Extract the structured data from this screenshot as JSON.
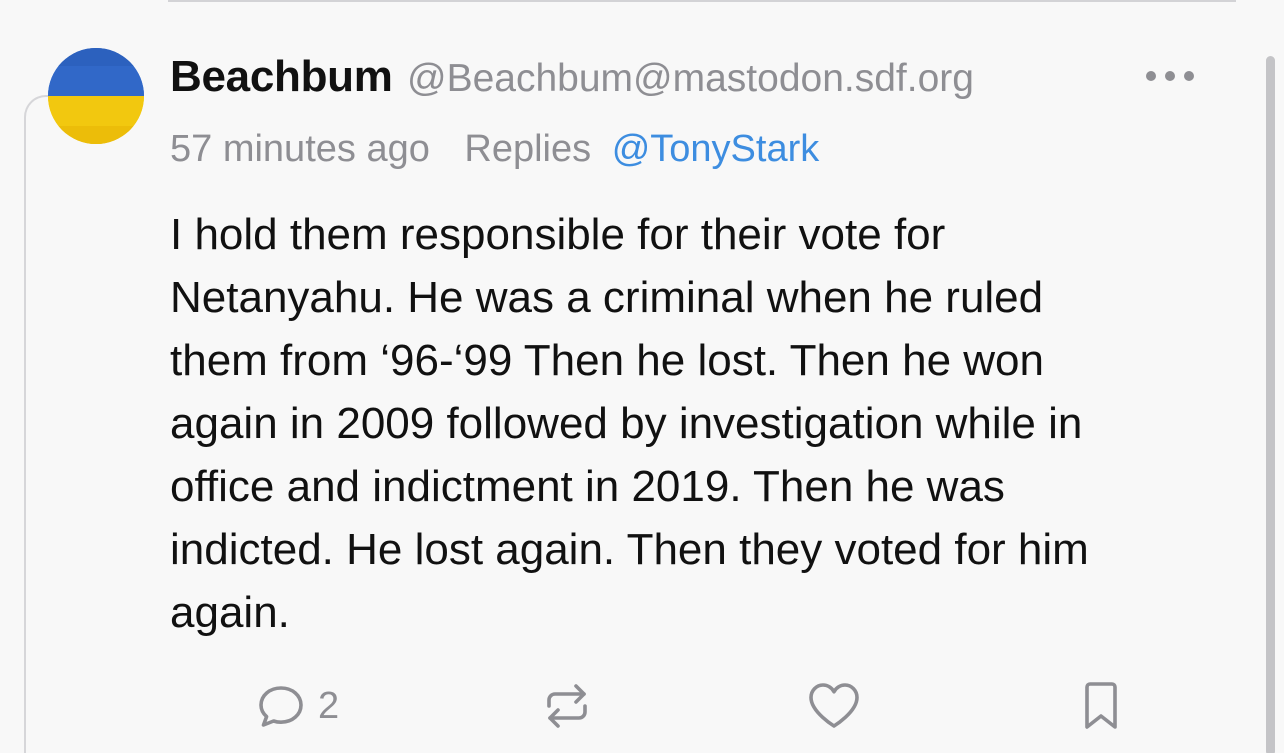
{
  "post": {
    "author": {
      "display_name": "Beachbum",
      "handle": "@Beachbum@mastodon.sdf.org",
      "avatar": "ukraine-flag-avatar",
      "avatar_colors": {
        "top": "#2a62c2",
        "bottom": "#f3cf12"
      }
    },
    "timestamp": "57 minutes ago",
    "replies_label": "Replies",
    "reply_to": "@TonyStark",
    "body_lines": [
      "I hold them responsible for their vote for",
      "Netanyahu. He was a criminal when he ruled",
      "them from ‘96-‘99 Then he lost. Then he won",
      "again in 2009 followed by investigation while in",
      "office and indictment in 2019. Then he was",
      "indicted. He lost again. Then they voted for him",
      "again."
    ],
    "actions": {
      "reply": {
        "icon": "reply-bubble-icon",
        "count": "2"
      },
      "boost": {
        "icon": "boost-icon"
      },
      "favorite": {
        "icon": "heart-icon"
      },
      "bookmark": {
        "icon": "bookmark-icon"
      }
    },
    "more_icon": "ellipsis-icon"
  },
  "colors": {
    "background": "#f8f8f8",
    "text": "#111111",
    "secondary_text": "#8e8e93",
    "mention": "#3d8de0"
  }
}
